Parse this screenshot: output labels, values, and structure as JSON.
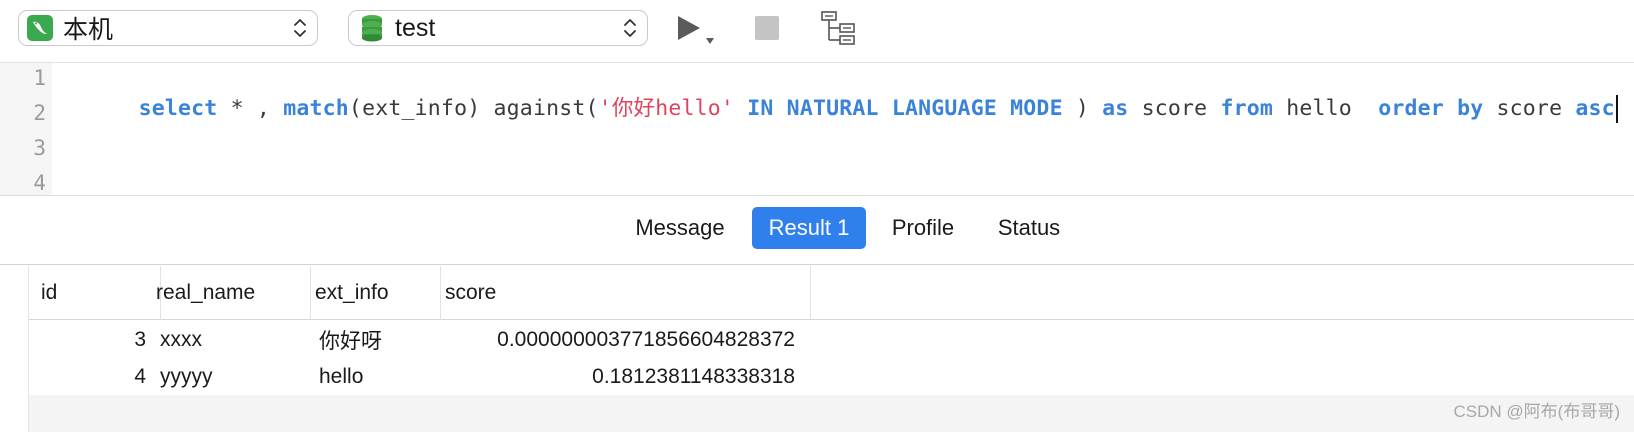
{
  "toolbar": {
    "connection": "本机",
    "database": "test",
    "run_icon": "play-icon",
    "stop_icon": "stop-icon",
    "explain_icon": "tree-icon"
  },
  "editor": {
    "line_numbers": [
      "1",
      "2",
      "3",
      "4"
    ],
    "code_tokens": [
      {
        "t": "select",
        "k": "kw"
      },
      {
        "t": " * , ",
        "k": ""
      },
      {
        "t": "match",
        "k": "kw"
      },
      {
        "t": "(ext_info) against(",
        "k": ""
      },
      {
        "t": "'你好hello'",
        "k": "str"
      },
      {
        "t": " ",
        "k": ""
      },
      {
        "t": "IN NATURAL LANGUAGE MODE",
        "k": "kw"
      },
      {
        "t": " ) ",
        "k": ""
      },
      {
        "t": "as",
        "k": "kw"
      },
      {
        "t": " score ",
        "k": ""
      },
      {
        "t": "from",
        "k": "kw"
      },
      {
        "t": " hello  ",
        "k": ""
      },
      {
        "t": "order by",
        "k": "kw"
      },
      {
        "t": " score ",
        "k": ""
      },
      {
        "t": "asc",
        "k": "kw"
      }
    ]
  },
  "tabs": {
    "message": "Message",
    "result": "Result 1",
    "profile": "Profile",
    "status": "Status",
    "active": "result"
  },
  "grid": {
    "columns": [
      "id",
      "real_name",
      "ext_info",
      "score"
    ],
    "rows": [
      [
        "3",
        "xxxx",
        "你好呀",
        "0.000000003771856604828372"
      ],
      [
        "4",
        "yyyyy",
        "hello",
        "0.1812381148338318"
      ]
    ]
  },
  "watermark": "CSDN @阿布(布哥哥)",
  "colors": {
    "keyword": "#3b82d9",
    "string": "#e0435c",
    "active_tab": "#2f80ed",
    "connection_icon": "#3aa84f",
    "database_icon": "#3e9a3c"
  }
}
